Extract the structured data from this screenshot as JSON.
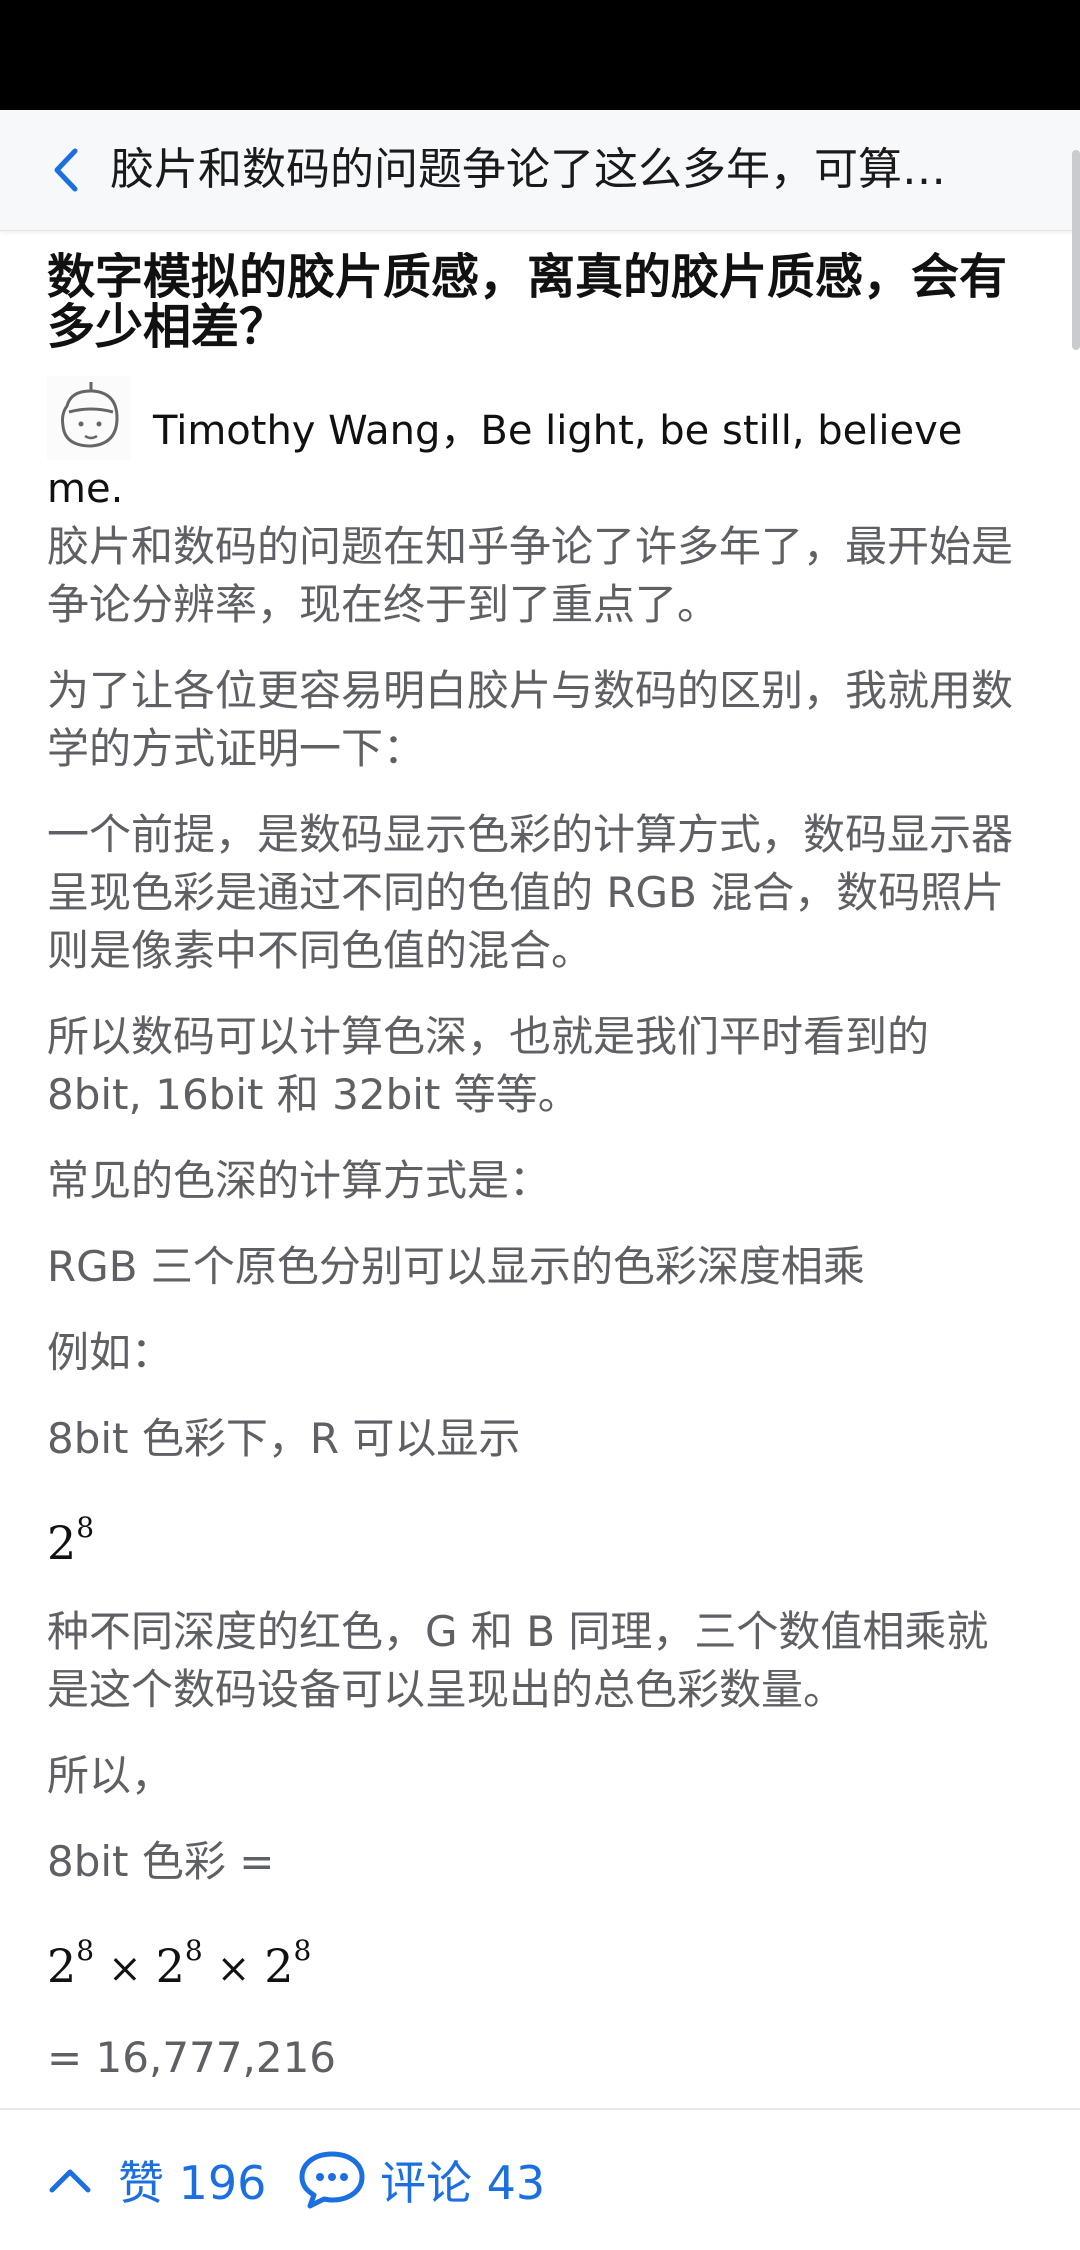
{
  "header": {
    "title": "胶片和数码的问题争论了这么多年，可算…"
  },
  "question": {
    "title": "数字模拟的胶片质感，离真的胶片质感，会有多少相差？"
  },
  "author": {
    "name": "Timothy Wang",
    "bio": "，Be light, be still, believe me."
  },
  "answer": {
    "paragraphs": [
      "胶片和数码的问题在知乎争论了许多年了，最开始是争论分辨率，现在终于到了重点了。",
      "为了让各位更容易明白胶片与数码的区别，我就用数学的方式证明一下：",
      "一个前提，是数码显示色彩的计算方式，数码显示器呈现色彩是通过不同的色值的 RGB 混合，数码照片则是像素中不同色值的混合。",
      "所以数码可以计算色深，也就是我们平时看到的 8bit, 16bit 和 32bit 等等。",
      "常见的色深的计算方式是：",
      "RGB 三个原色分别可以显示的色彩深度相乘",
      "例如：",
      "8bit 色彩下，R 可以显示",
      "种不同深度的红色，G 和 B 同理，三个数值相乘就是这个数码设备可以呈现出的总色彩数量。",
      "所以，",
      "8bit 色彩 =",
      "= 16,777,216"
    ],
    "formula1": {
      "base": "2",
      "exp": "8"
    },
    "formula2": {
      "base": "2",
      "exp": "8",
      "op": "×"
    }
  },
  "bottom_bar": {
    "vote_label": "赞 196",
    "comment_label": "评论 43"
  },
  "colors": {
    "accent": "#1c6fe0",
    "body_text": "#5f6064",
    "status_bar": "#000000"
  }
}
